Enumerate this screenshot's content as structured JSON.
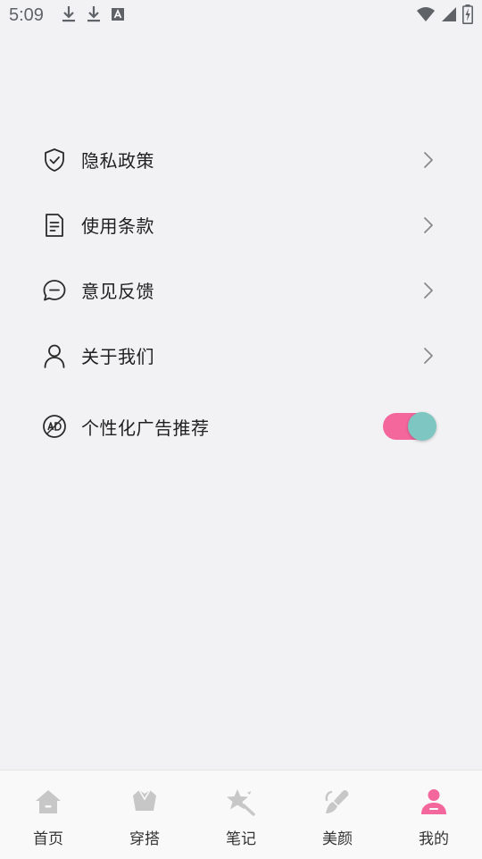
{
  "status_bar": {
    "time": "5:09",
    "icons_left": [
      "download-icon",
      "download-icon",
      "a-badge-icon"
    ],
    "icons_right": [
      "wifi-icon",
      "signal-icon",
      "battery-icon"
    ]
  },
  "menu": {
    "items": [
      {
        "label": "隐私政策",
        "icon": "shield-check-icon"
      },
      {
        "label": "使用条款",
        "icon": "document-icon"
      },
      {
        "label": "意见反馈",
        "icon": "chat-bubble-icon"
      },
      {
        "label": "关于我们",
        "icon": "user-icon"
      }
    ],
    "toggle_item": {
      "label": "个性化广告推荐",
      "icon": "ad-icon",
      "enabled": true
    }
  },
  "bottom_nav": {
    "tabs": [
      {
        "label": "首页",
        "icon": "home-icon"
      },
      {
        "label": "穿搭",
        "icon": "outfit-icon"
      },
      {
        "label": "笔记",
        "icon": "notes-star-icon"
      },
      {
        "label": "美颜",
        "icon": "beauty-brush-icon"
      },
      {
        "label": "我的",
        "icon": "profile-icon"
      }
    ],
    "active_index": 4
  },
  "colors": {
    "background": "#f2f2f4",
    "accent_pink": "#f4679d",
    "toggle_knob": "#7dc6c1",
    "inactive_icon": "#c7c7c7",
    "chevron": "#8a8a8a"
  }
}
